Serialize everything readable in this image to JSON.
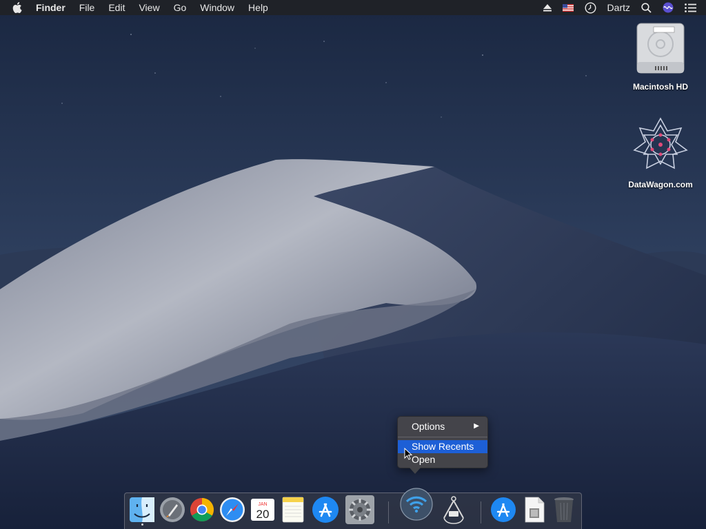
{
  "menubar": {
    "apple_icon": "apple-icon",
    "items": [
      "Finder",
      "File",
      "Edit",
      "View",
      "Go",
      "Window",
      "Help"
    ],
    "right": {
      "eject_icon": "eject-icon",
      "flag_icon": "us-flag-icon",
      "time_machine_icon": "time-machine-icon",
      "user": "Dartz",
      "search_icon": "search-icon",
      "siri_icon": "siri-icon",
      "notifications_icon": "notification-center-icon"
    }
  },
  "desktop": {
    "icons": [
      {
        "label": "Macintosh HD",
        "icon": "hard-drive-icon"
      },
      {
        "label": "DataWagon.com",
        "icon": "datawagon-logo-icon"
      }
    ]
  },
  "context_menu": {
    "options": "Options",
    "show_recents": "Show Recents",
    "open": "Open",
    "submenu_arrow": "▶"
  },
  "dock": {
    "apps": [
      {
        "name": "Finder",
        "icon": "finder-icon",
        "running": true
      },
      {
        "name": "Launchpad",
        "icon": "launchpad-icon"
      },
      {
        "name": "Google Chrome",
        "icon": "chrome-icon"
      },
      {
        "name": "Safari",
        "icon": "safari-icon"
      },
      {
        "name": "Calendar",
        "icon": "calendar-icon",
        "month": "JAN",
        "day": "20"
      },
      {
        "name": "Notes",
        "icon": "notes-icon"
      },
      {
        "name": "App Store",
        "icon": "app-store-icon"
      },
      {
        "name": "System Preferences",
        "icon": "system-preferences-icon"
      },
      {
        "name": "Wireless Diagnostics",
        "icon": "wifi-icon"
      },
      {
        "name": "Directory Utility",
        "icon": "caliper-icon"
      },
      {
        "name": "Applications",
        "icon": "applications-folder-icon"
      },
      {
        "name": "Documents",
        "icon": "document-stack-icon"
      },
      {
        "name": "Trash",
        "icon": "trash-icon"
      }
    ]
  },
  "colors": {
    "menu_highlight": "#1d5fd6",
    "sky_top": "#1a2741",
    "dune_light": "#a6abb8"
  }
}
